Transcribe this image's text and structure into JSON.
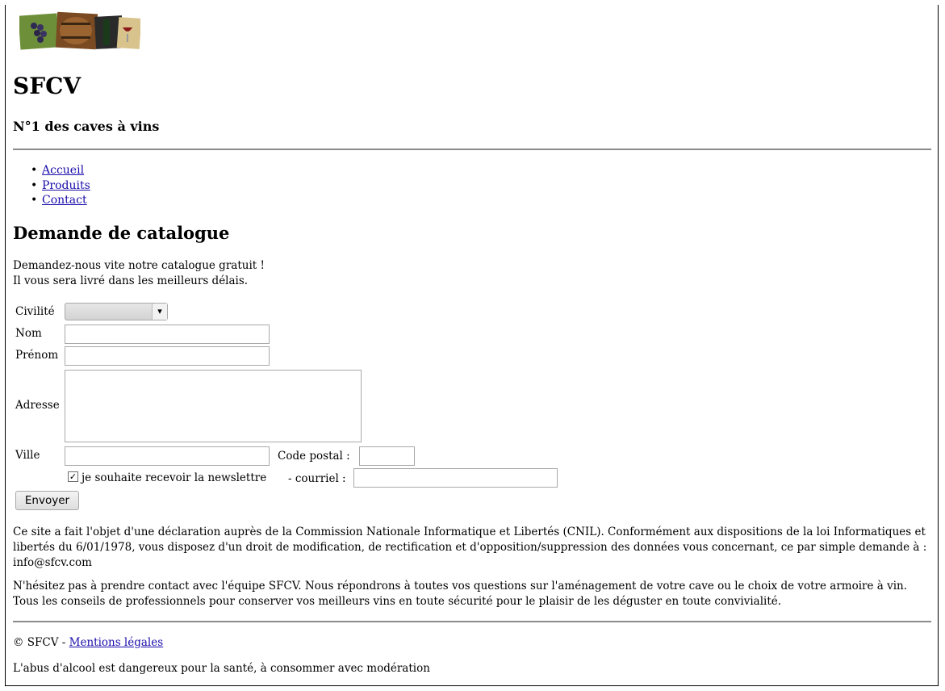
{
  "header": {
    "logo_name": "wine-collage-logo",
    "title": "SFCV",
    "tagline": "N°1 des caves à vins"
  },
  "nav": {
    "items": [
      {
        "label": "Accueil"
      },
      {
        "label": "Produits"
      },
      {
        "label": "Contact"
      }
    ]
  },
  "main": {
    "heading": "Demande de catalogue",
    "intro_line1": "Demandez-nous vite notre catalogue gratuit !",
    "intro_line2": "Il vous sera livré dans les meilleurs délais."
  },
  "form": {
    "civilite_label": "Civilité",
    "civilite_value": "",
    "nom_label": "Nom",
    "nom_value": "",
    "prenom_label": "Prénom",
    "prenom_value": "",
    "adresse_label": "Adresse",
    "adresse_value": "",
    "ville_label": "Ville",
    "ville_value": "",
    "code_postal_label": "Code postal :",
    "code_postal_value": "",
    "newsletter_checked": true,
    "newsletter_label": "je souhaite recevoir la newslettre",
    "courriel_label": "- courriel :",
    "courriel_value": "",
    "submit_label": "Envoyer"
  },
  "info": {
    "cnil_text": "Ce site a fait l'objet d'une déclaration auprès de la Commission Nationale Informatique et Libertés (CNIL). Conformément aux dispositions de la loi Informatiques et libertés du 6/01/1978, vous disposez d'un droit de modification, de rectification et d'opposition/suppression des données vous concernant, ce par simple demande à : info@sfcv.com",
    "contact_text": "N'hésitez pas à prendre contact avec l'équipe SFCV. Nous répondrons à toutes vos questions sur l'aménagement de votre cave ou le choix de votre armoire à vin. Tous les conseils de professionnels pour conserver vos meilleurs vins en toute sécurité pour le plaisir de les déguster en toute convivialité."
  },
  "footer": {
    "copyright": "© SFCV -",
    "legal_link": "Mentions légales",
    "warning": "L'abus d'alcool est dangereux pour la santé, à consommer avec modération"
  },
  "colors": {
    "link": "#1a0dab",
    "rule": "#8a8a8a"
  }
}
